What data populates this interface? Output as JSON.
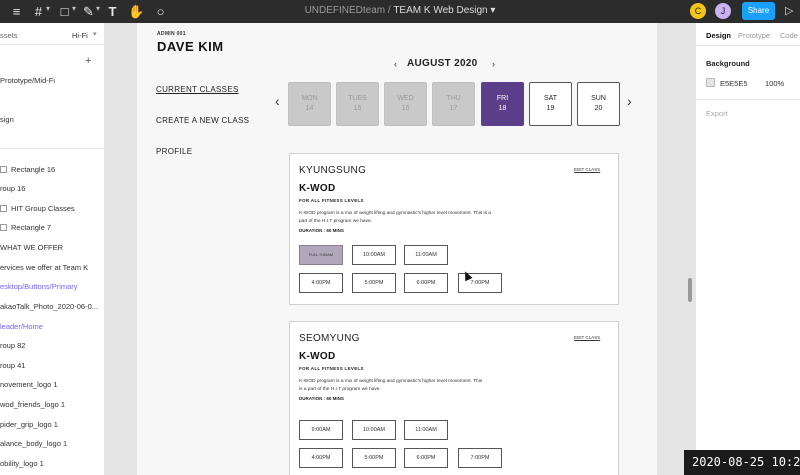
{
  "toolbar": {
    "breadcrumb_team": "UNDEFINEDteam",
    "breadcrumb_sep": "/",
    "file_title": "TEAM K Web Design",
    "avatar_1": "C",
    "avatar_2": "J",
    "share_label": "Share",
    "icons": [
      "frame-icon",
      "shape-icon",
      "pen-icon",
      "text-icon",
      "hand-icon",
      "comment-icon",
      "play-icon"
    ]
  },
  "left_panel": {
    "tab_assets": "ssets",
    "page_selector": "Hi-Fi",
    "layers": [
      "Prototype/Mid-Fi",
      "sign",
      "Rectangle 16",
      "roup 16",
      "HIT Group Classes",
      "Rectangle 7",
      "WHAT WE OFFER",
      "ervices we offer at Team K",
      "esktop/Buttons/Primary",
      "akaoTalk_Photo_2020-06-0...",
      "leader/Home",
      "roup 82",
      "roup 41",
      "novement_logo 1",
      "wod_friends_logo 1",
      "pider_grip_logo 1",
      "alance_body_logo 1",
      "obility_logo 1"
    ]
  },
  "design": {
    "admin_label": "ADMIN 001",
    "admin_name": "DAVE KIM",
    "nav": [
      "CURRENT CLASSES",
      "CREATE A NEW CLASS",
      "PROFILE"
    ],
    "month": "AUGUST 2020",
    "days": [
      {
        "name": "MON",
        "num": "14",
        "state": "past"
      },
      {
        "name": "TUES",
        "num": "15",
        "state": "past"
      },
      {
        "name": "WED",
        "num": "16",
        "state": "past"
      },
      {
        "name": "THU",
        "num": "17",
        "state": "past"
      },
      {
        "name": "FRI",
        "num": "18",
        "state": "selected"
      },
      {
        "name": "SAT",
        "num": "19",
        "state": "future"
      },
      {
        "name": "SUN",
        "num": "20",
        "state": "future"
      }
    ],
    "cards": [
      {
        "location": "KYUNGSUNG",
        "edit": "EDIT CLASS",
        "title": "K-WOD",
        "subtitle": "FOR ALL FITNESS LEVELS",
        "desc1": "K-WOD program is a mix of weight lifting and gymnastic's higher level movement. This is a",
        "desc2": "part of the H.I.T program we have.",
        "duration": "DURATION : 60 MINS",
        "slots": [
          "FULL 9:00AM",
          "10:00AM",
          "11:00AM",
          "4:00PM",
          "5:00PM",
          "6:00PM",
          "7:00PM"
        ]
      },
      {
        "location": "SEOMYUNG",
        "edit": "EDIT CLASS",
        "title": "K-WOD",
        "subtitle": "FOR ALL FITNESS LEVELS",
        "desc1": "K-WOD program is a mix of weight lifting and gymnastic's higher level movement. This",
        "desc2": "is a part of the H.I.T program we have.",
        "duration": "DURATION : 60 MINS",
        "slots": [
          "9:00AM",
          "10:00AM",
          "11:00AM",
          "4:00PM",
          "5:00PM",
          "6:00PM",
          "7:00PM"
        ]
      }
    ]
  },
  "right_panel": {
    "tabs": [
      "Design",
      "Prototype",
      "Code"
    ],
    "background_label": "Background",
    "background_hex": "E5E5E5",
    "background_opacity": "100%",
    "export_label": "Export"
  },
  "overlay": {
    "timestamp": "2020-08-25 10:2"
  },
  "colors": {
    "accent_purple": "#5b3f8a",
    "share_blue": "#18a0fb",
    "full_slot": "#b1a7ba",
    "layer_link_purple": "#7b61ff"
  }
}
